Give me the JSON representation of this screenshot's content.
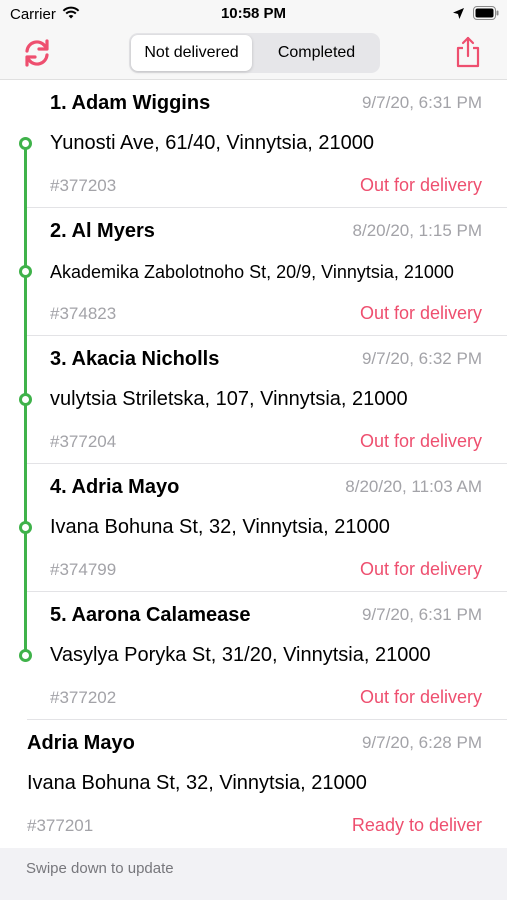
{
  "status_bar": {
    "carrier": "Carrier",
    "time": "10:58 PM",
    "icons": [
      "wifi-icon",
      "location-icon",
      "battery-icon"
    ]
  },
  "nav": {
    "refresh_icon": "refresh-icon",
    "share_icon": "share-icon",
    "segments": [
      {
        "label": "Not delivered",
        "selected": true
      },
      {
        "label": "Completed",
        "selected": false
      }
    ],
    "accent_color": "#ee4f6f"
  },
  "orders": [
    {
      "name": "1. Adam Wiggins",
      "date": "9/7/20, 6:31 PM",
      "address": "Yunosti Ave, 61/40, Vinnytsia, 21000",
      "number": "#377203",
      "status": "Out for delivery",
      "on_route": true
    },
    {
      "name": "2. Al Myers",
      "date": "8/20/20, 1:15 PM",
      "address": "Akademika Zabolotnoho St, 20/9, Vinnytsia, 21000",
      "number": "#374823",
      "status": "Out for delivery",
      "on_route": true
    },
    {
      "name": "3. Akacia Nicholls",
      "date": "9/7/20, 6:32 PM",
      "address": "vulytsia Striletska, 107, Vinnytsia, 21000",
      "number": "#377204",
      "status": "Out for delivery",
      "on_route": true
    },
    {
      "name": "4. Adria Mayo",
      "date": "8/20/20, 11:03 AM",
      "address": "Ivana Bohuna St, 32, Vinnytsia, 21000",
      "number": "#374799",
      "status": "Out for delivery",
      "on_route": true
    },
    {
      "name": "5. Aarona Calamease",
      "date": "9/7/20, 6:31 PM",
      "address": "Vasylya Poryka St, 31/20, Vinnytsia, 21000",
      "number": "#377202",
      "status": "Out for delivery",
      "on_route": true
    },
    {
      "name": "Adria Mayo",
      "date": "9/7/20, 6:28 PM",
      "address": "Ivana Bohuna St, 32, Vinnytsia, 21000",
      "number": "#377201",
      "status": "Ready to deliver",
      "on_route": false
    }
  ],
  "route_color": "#3fb24a",
  "footer": {
    "hint": "Swipe down to update"
  }
}
